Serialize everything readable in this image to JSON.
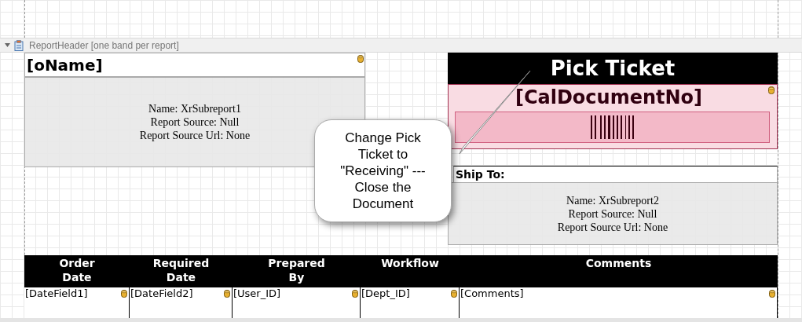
{
  "band": {
    "title": "ReportHeader [one band per report]",
    "expanded": true
  },
  "name_field": "[oName]",
  "subreport_1": {
    "lines": [
      "Name: XrSubreport1",
      "Report Source: Null",
      "Report Source Url: None"
    ]
  },
  "title": "Pick Ticket",
  "document_no": "[CalDocumentNo]",
  "ship_to_label": "Ship To:",
  "subreport_2": {
    "lines": [
      "Name: XrSubreport2",
      "Report Source: Null",
      "Report Source Url: None"
    ]
  },
  "callout": "Change Pick Ticket to \"Receiving\" --- Close the Document",
  "table": {
    "columns": [
      {
        "lines": [
          "Order",
          "Date"
        ]
      },
      {
        "lines": [
          "Required",
          "Date"
        ]
      },
      {
        "lines": [
          "Prepared",
          "By"
        ]
      },
      {
        "lines": [
          "Workflow"
        ]
      },
      {
        "lines": [
          "Comments"
        ]
      }
    ],
    "rows": [
      [
        "[DateField1]",
        "[DateField2]",
        "[User_ID]",
        "[Dept_ID]",
        "[Comments]"
      ]
    ]
  }
}
